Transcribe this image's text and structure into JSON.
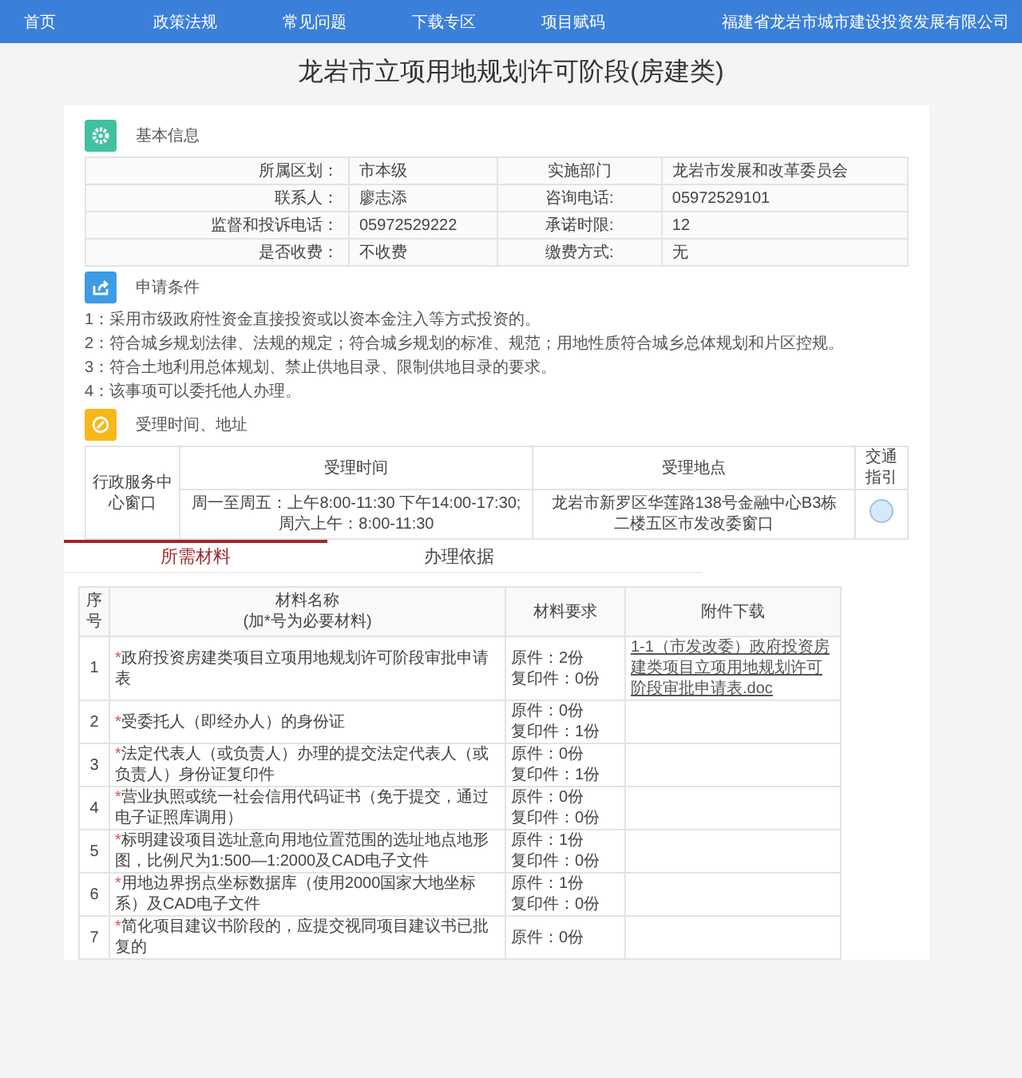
{
  "nav": {
    "items": [
      {
        "label": "首页"
      },
      {
        "label": "政策法规"
      },
      {
        "label": "常见问题"
      },
      {
        "label": "下载专区"
      },
      {
        "label": "项目赋码"
      }
    ],
    "org": "福建省龙岩市城市建设投资发展有限公司"
  },
  "title": "龙岩市立项用地规划许可阶段(房建类)",
  "basic": {
    "heading": "基本信息",
    "rows": [
      {
        "label1": "所属区划：",
        "value1": "市本级",
        "label2": "实施部门",
        "value2": "龙岩市发展和改革委员会"
      },
      {
        "label1": "联系人：",
        "value1": "廖志添",
        "label2": "咨询电话:",
        "value2": "05972529101"
      },
      {
        "label1": "监督和投诉电话：",
        "value1": "05972529222",
        "label2": "承诺时限:",
        "value2": "12"
      },
      {
        "label1": "是否收费：",
        "value1": "不收费",
        "label2": "缴费方式:",
        "value2": "无"
      }
    ]
  },
  "conditions": {
    "heading": "申请条件",
    "items": [
      "1：采用市级政府性资金直接投资或以资本金注入等方式投资的。",
      "2：符合城乡规划法律、法规的规定；符合城乡规划的标准、规范；用地性质符合城乡总体规划和片区控规。",
      "3：符合土地利用总体规划、禁止供地目录、限制供地目录的要求。",
      "4：该事项可以委托他人办理。"
    ]
  },
  "hours": {
    "heading": "受理时间、地址",
    "window": "行政服务中心窗口",
    "col_time": "受理时间",
    "col_place": "受理地点",
    "col_guide": "交通指引",
    "time": "周一至周五：上午8:00-11:30 下午14:00-17:30;周六上午：8:00-11:30",
    "place": "龙岩市新罗区华莲路138号金融中心B3栋二楼五区市发改委窗口"
  },
  "tabs": [
    {
      "label": "所需材料",
      "selected": true
    },
    {
      "label": "办理依据",
      "selected": false
    }
  ],
  "materials": {
    "columns": [
      "序号",
      "材料名称\n(加*号为必要材料)",
      "材料要求",
      "附件下载"
    ],
    "rows": [
      {
        "no": "1",
        "mark": "*",
        "name": "政府投资房建类项目立项用地规划许可阶段审批申请表",
        "req": [
          "原件：2份",
          "复印件：0份"
        ],
        "download": "1-1（市发改委）政府投资房建类项目立项用地规划许可阶段审批申请表.doc"
      },
      {
        "no": "2",
        "mark": "*",
        "name": "受委托人（即经办人）的身份证",
        "req": [
          "原件：0份",
          "复印件：1份"
        ]
      },
      {
        "no": "3",
        "mark": "*",
        "name": "法定代表人（或负责人）办理的提交法定代表人（或负责人）身份证复印件",
        "req": [
          "原件：0份",
          "复印件：1份"
        ]
      },
      {
        "no": "4",
        "mark": "*",
        "name": "营业执照或统一社会信用代码证书（免于提交，通过电子证照库调用）",
        "req": [
          "原件：0份",
          "复印件：0份"
        ]
      },
      {
        "no": "5",
        "mark": "*",
        "name": "标明建设项目选址意向用地位置范围的选址地点地形图，比例尺为1:500—1:2000及CAD电子文件",
        "req": [
          "原件：1份",
          "复印件：0份"
        ]
      },
      {
        "no": "6",
        "mark": "*",
        "name": "用地边界拐点坐标数据库（使用2000国家大地坐标系）及CAD电子文件",
        "req": [
          "原件：1份",
          "复印件：0份"
        ]
      },
      {
        "no": "7",
        "mark": "*",
        "name": "简化项目建议书阶段的，应提交视同项目建议书已批复的",
        "req": [
          "原件：0份"
        ]
      }
    ]
  }
}
